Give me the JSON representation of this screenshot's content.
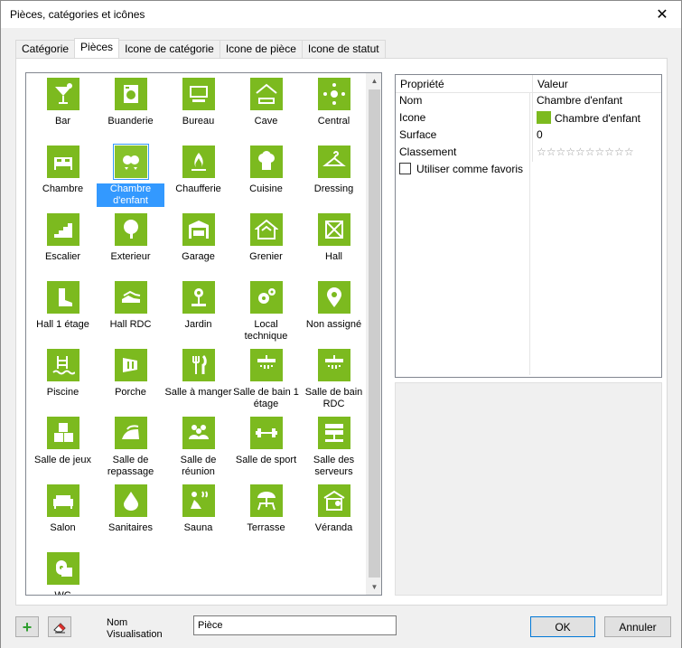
{
  "window": {
    "title": "Pièces, catégories et icônes",
    "close_glyph": "✕"
  },
  "tabs": [
    "Catégorie",
    "Pièces",
    "Icone de catégorie",
    "Icone de pièce",
    "Icone de statut"
  ],
  "active_tab": 1,
  "items": [
    {
      "label": "Bar",
      "icon": "cocktail-icon"
    },
    {
      "label": "Buanderie",
      "icon": "washing-machine-icon"
    },
    {
      "label": "Bureau",
      "icon": "computer-icon"
    },
    {
      "label": "Cave",
      "icon": "cellar-icon"
    },
    {
      "label": "Central",
      "icon": "network-hub-icon"
    },
    {
      "label": "Chambre",
      "icon": "bed-icon"
    },
    {
      "label": "Chambre d'enfant",
      "icon": "mobile-toy-icon",
      "selected": true
    },
    {
      "label": "Chaufferie",
      "icon": "flame-icon"
    },
    {
      "label": "Cuisine",
      "icon": "chef-hat-icon"
    },
    {
      "label": "Dressing",
      "icon": "hanger-icon"
    },
    {
      "label": "Escalier",
      "icon": "stairs-icon"
    },
    {
      "label": "Exterieur",
      "icon": "tree-icon"
    },
    {
      "label": "Garage",
      "icon": "garage-icon"
    },
    {
      "label": "Grenier",
      "icon": "attic-icon"
    },
    {
      "label": "Hall",
      "icon": "hall-icon"
    },
    {
      "label": "Hall 1 étage",
      "icon": "boot-icon"
    },
    {
      "label": "Hall RDC",
      "icon": "shoes-icon"
    },
    {
      "label": "Jardin",
      "icon": "flower-icon"
    },
    {
      "label": "Local technique",
      "icon": "gears-icon"
    },
    {
      "label": "Non assigné",
      "icon": "location-pin-icon"
    },
    {
      "label": "Piscine",
      "icon": "pool-icon"
    },
    {
      "label": "Porche",
      "icon": "lamp-icon"
    },
    {
      "label": "Salle à manger",
      "icon": "fork-knife-icon"
    },
    {
      "label": "Salle de bain 1 étage",
      "icon": "shower-icon"
    },
    {
      "label": "Salle de bain RDC",
      "icon": "shower-icon"
    },
    {
      "label": "Salle de jeux",
      "icon": "abc-blocks-icon"
    },
    {
      "label": "Salle de repassage",
      "icon": "iron-icon"
    },
    {
      "label": "Salle de réunion",
      "icon": "people-icon"
    },
    {
      "label": "Salle de sport",
      "icon": "dumbbell-icon"
    },
    {
      "label": "Salle des serveurs",
      "icon": "server-icon"
    },
    {
      "label": "Salon",
      "icon": "sofa-icon"
    },
    {
      "label": "Sanitaires",
      "icon": "drop-icon"
    },
    {
      "label": "Sauna",
      "icon": "sauna-icon"
    },
    {
      "label": "Terrasse",
      "icon": "parasol-icon"
    },
    {
      "label": "Véranda",
      "icon": "veranda-icon"
    },
    {
      "label": "WC",
      "icon": "toilet-paper-icon"
    }
  ],
  "properties": {
    "header_property": "Propriété",
    "header_value": "Valeur",
    "rows": [
      {
        "name": "Nom",
        "value": "Chambre d'enfant"
      },
      {
        "name": "Icone",
        "value": "Chambre d'enfant"
      },
      {
        "name": "Surface",
        "value": "0"
      },
      {
        "name": "Classement",
        "value": "☆☆☆☆☆☆☆☆☆☆"
      }
    ],
    "favorite_label": "Utiliser comme favoris",
    "favorite_checked": false,
    "rating": 0
  },
  "footer": {
    "nom_label": "Nom Visualisation",
    "nom_value": "Pièce",
    "ok_label": "OK",
    "cancel_label": "Annuler",
    "add_glyph": "+"
  },
  "colors": {
    "tile_green": "#7cba1f",
    "selection_blue": "#3399ff"
  }
}
